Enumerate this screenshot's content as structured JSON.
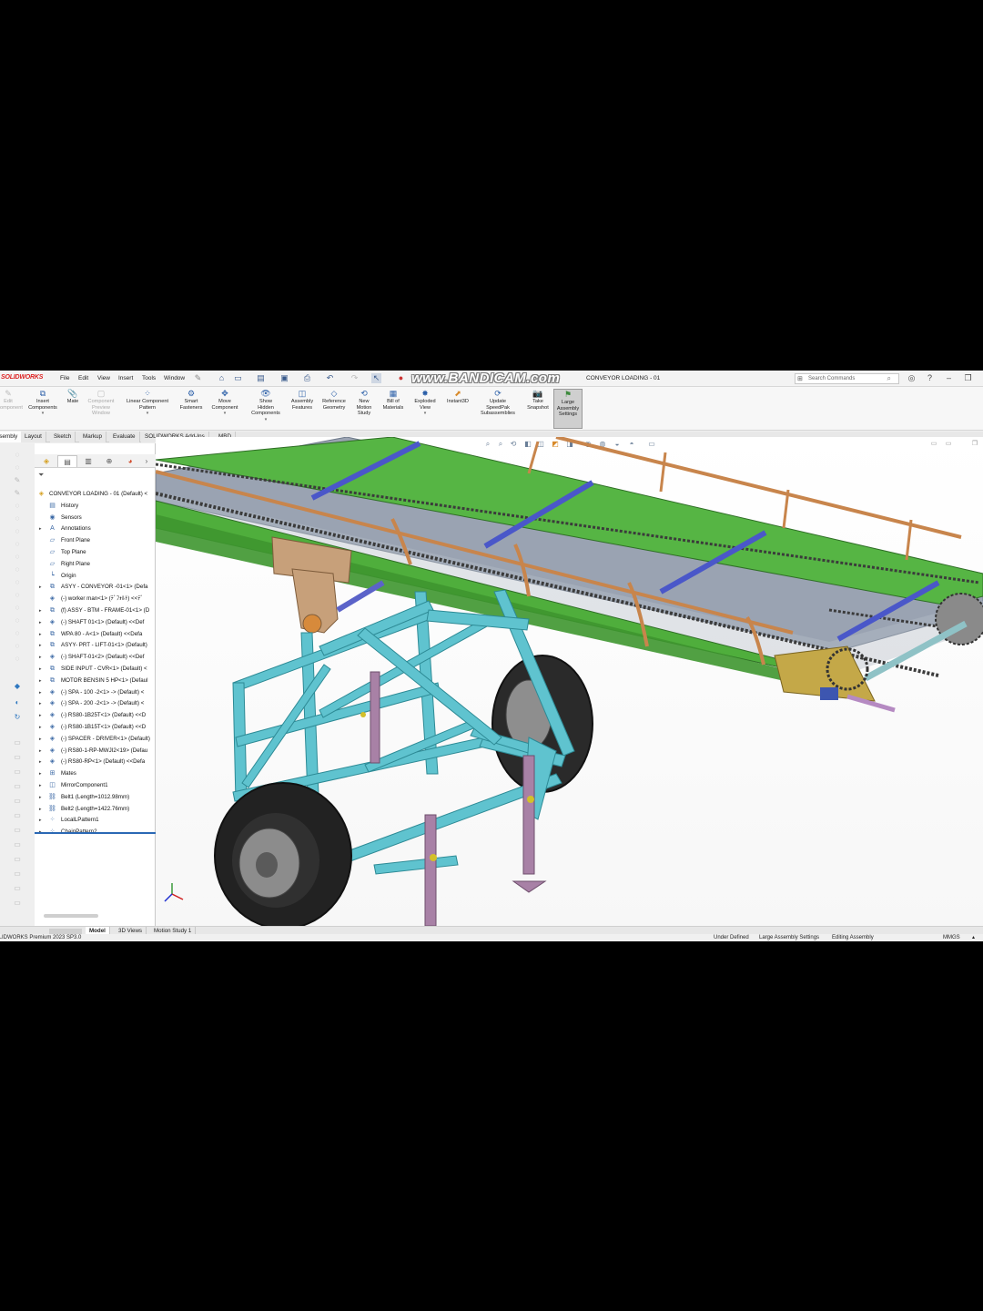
{
  "app": {
    "logo": "SOLIDWORKS",
    "menu": [
      "File",
      "Edit",
      "View",
      "Insert",
      "Tools",
      "Window"
    ],
    "watermark": "www.BANDICAM.com",
    "document_title": "CONVEYOR LOADING - 01",
    "search_placeholder": "Search Commands"
  },
  "ribbon": {
    "items": [
      {
        "label": "Edit\nComponent",
        "icon": "edit-component-icon",
        "dim": true
      },
      {
        "label": "Insert\nComponents",
        "icon": "insert-components-icon"
      },
      {
        "label": "Mate",
        "icon": "mate-icon"
      },
      {
        "label": "Component\nPreview\nWindow",
        "icon": "component-preview-icon",
        "dim": true
      },
      {
        "label": "Linear Component\nPattern",
        "icon": "linear-pattern-icon"
      },
      {
        "label": "Smart\nFasteners",
        "icon": "smart-fasteners-icon"
      },
      {
        "label": "Move\nComponent",
        "icon": "move-component-icon"
      },
      {
        "label": "Show\nHidden\nComponents",
        "icon": "show-hidden-icon"
      },
      {
        "label": "Assembly\nFeatures",
        "icon": "assembly-features-icon"
      },
      {
        "label": "Reference\nGeometry",
        "icon": "reference-geometry-icon"
      },
      {
        "label": "New\nMotion\nStudy",
        "icon": "motion-study-icon"
      },
      {
        "label": "Bill of\nMaterials",
        "icon": "bom-icon"
      },
      {
        "label": "Exploded\nView",
        "icon": "exploded-view-icon"
      },
      {
        "label": "Instant3D",
        "icon": "instant3d-icon"
      },
      {
        "label": "Update\nSpeedPak\nSubassemblies",
        "icon": "speedpak-icon"
      },
      {
        "label": "Take\nSnapshot",
        "icon": "snapshot-icon"
      },
      {
        "label": "Large\nAssembly\nSettings",
        "icon": "large-assembly-icon",
        "active": true
      }
    ]
  },
  "command_tabs": [
    "Assembly",
    "Layout",
    "Sketch",
    "Markup",
    "Evaluate",
    "SOLIDWORKS Add-Ins",
    "MBD"
  ],
  "feature_tree": {
    "root": "CONVEYOR LOADING - 01 (Default) <",
    "items": [
      {
        "label": "History",
        "icon": "history-icon",
        "expand": false
      },
      {
        "label": "Sensors",
        "icon": "sensors-icon",
        "expand": false
      },
      {
        "label": "Annotations",
        "icon": "annotations-icon",
        "expand": true
      },
      {
        "label": "Front Plane",
        "icon": "plane-icon",
        "expand": false
      },
      {
        "label": "Top Plane",
        "icon": "plane-icon",
        "expand": false
      },
      {
        "label": "Right Plane",
        "icon": "plane-icon",
        "expand": false
      },
      {
        "label": "Origin",
        "icon": "origin-icon",
        "expand": false
      },
      {
        "label": "ASYY - CONVEYOR -01<1> (Defa",
        "icon": "assembly-icon",
        "expand": true
      },
      {
        "label": "(-) worker man<1> (ﾃﾞﾌｫﾙﾄ) <<ﾃﾞ",
        "icon": "part-icon",
        "expand": false
      },
      {
        "label": "(f) ASSY - BTM - FRAME-01<1> (D",
        "icon": "assembly-icon",
        "expand": true
      },
      {
        "label": "(-) SHAFT 01<1> (Default) <<Def",
        "icon": "part-icon",
        "expand": true
      },
      {
        "label": "WPA 80 - A<1> (Default) <<Defa",
        "icon": "assembly-icon",
        "expand": true
      },
      {
        "label": "ASYY- PRT - LIFT-01<1> (Default)",
        "icon": "assembly-icon",
        "expand": true
      },
      {
        "label": "(-) SHAFT-01<2> (Default) <<Def",
        "icon": "part-icon",
        "expand": true
      },
      {
        "label": "SIDE INPUT - CVR<1> (Default) <",
        "icon": "assembly-icon",
        "expand": true
      },
      {
        "label": "MOTOR BENSIN 5 HP<1> (Defaul",
        "icon": "assembly-icon",
        "expand": true
      },
      {
        "label": "(-) SPA - 100 -2<1> -> (Default) <",
        "icon": "part-icon",
        "expand": true
      },
      {
        "label": "(-) SPA - 200 -2<1> -> (Default) <",
        "icon": "part-icon",
        "expand": true
      },
      {
        "label": "(-) RS80-1B25T<1> (Default) <<D",
        "icon": "part-icon",
        "expand": true
      },
      {
        "label": "(-) RS80-1B15T<1> (Default) <<D",
        "icon": "part-icon",
        "expand": true
      },
      {
        "label": "(-) SPACER - DRIVER<1> (Default)",
        "icon": "part-icon",
        "expand": true
      },
      {
        "label": "(-) RS80-1-RP-MWJI2<19> (Defau",
        "icon": "part-icon",
        "expand": true
      },
      {
        "label": "(-) RS80-RP<1> (Default) <<Defa",
        "icon": "part-icon",
        "expand": true
      },
      {
        "label": "Mates",
        "icon": "mates-icon",
        "expand": true
      },
      {
        "label": "MirrorComponent1",
        "icon": "mirror-icon",
        "expand": true
      },
      {
        "label": "Belt1 (Length=1012.98mm)",
        "icon": "belt-icon",
        "expand": true
      },
      {
        "label": "Belt2 (Length=1422.76mm)",
        "icon": "belt-icon",
        "expand": true
      },
      {
        "label": "LocalLPattern1",
        "icon": "pattern-icon",
        "expand": true
      },
      {
        "label": "ChainPattern2",
        "icon": "pattern-icon",
        "expand": true
      }
    ]
  },
  "bottom_tabs": [
    "Model",
    "3D Views",
    "Motion Study 1"
  ],
  "status": {
    "product": "SOLIDWORKS Premium 2023 SP3.0",
    "state": "Under Defined",
    "large_assembly": "Large Assembly Settings",
    "mode": "Editing Assembly",
    "units": "MMGS"
  },
  "colors": {
    "frame_cyan": "#5fc3cf",
    "conveyor_green": "#4fae3c",
    "crossbar_blue": "#4a57c9",
    "rail_tan": "#c8854c",
    "jack_purple": "#a881a6",
    "belt_gray": "#9aa3b2"
  }
}
